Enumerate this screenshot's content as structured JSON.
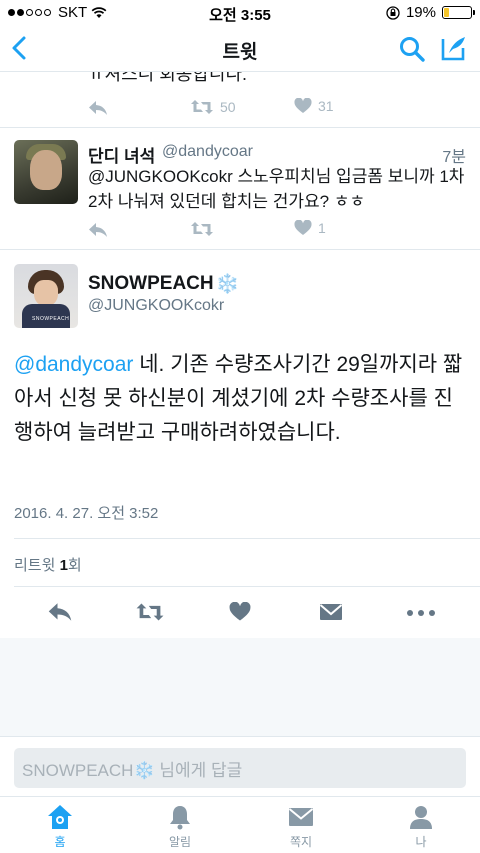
{
  "status_bar": {
    "carrier": "SKT",
    "time": "오전 3:55",
    "battery_percent": "19%",
    "battery_level": 0.19,
    "colors": {
      "battery": "#f5c52a"
    }
  },
  "nav": {
    "title": "트윗",
    "icons": [
      "back-chevron-icon",
      "search-icon",
      "compose-icon"
    ],
    "accent": "#1da1f2"
  },
  "tweet_prev": {
    "partial_text": "ㅠ셔스니 회송합니다.",
    "retweets": "50",
    "likes": "31"
  },
  "tweet_reply": {
    "name": "단디 녀석",
    "handle": "@dandycoar",
    "time": "7분",
    "text": "@JUNGKOOKcokr 스노우피치님 입금폼 보니까 1차 2차 나눠져 있던데 합치는 건가요? ㅎㅎ",
    "likes": "1"
  },
  "tweet_main": {
    "name": "SNOWPEACH",
    "name_emoji": "❄️",
    "handle": "@JUNGKOOKcokr",
    "mention": "@dandycoar",
    "text": " 네. 기존 수량조사기간 29일까지라 짧아서 신청 못 하신분이 계셨기에 2차 수량조사를 진행하여 늘려받고 구매하려하였습니다.",
    "avatar_watermark": "SNOWPEACH",
    "date": "2016. 4. 27. 오전 3:52",
    "retweet_label": "리트윗",
    "retweet_count": "1",
    "retweet_unit": "회"
  },
  "reply_bar": {
    "placeholder": "SNOWPEACH❄️ 님에게 답글"
  },
  "tabs": [
    {
      "label": "홈",
      "icon": "home-icon",
      "active": true
    },
    {
      "label": "알림",
      "icon": "bell-icon",
      "active": false
    },
    {
      "label": "쪽지",
      "icon": "envelope-icon",
      "active": false
    },
    {
      "label": "나",
      "icon": "person-icon",
      "active": false
    }
  ]
}
